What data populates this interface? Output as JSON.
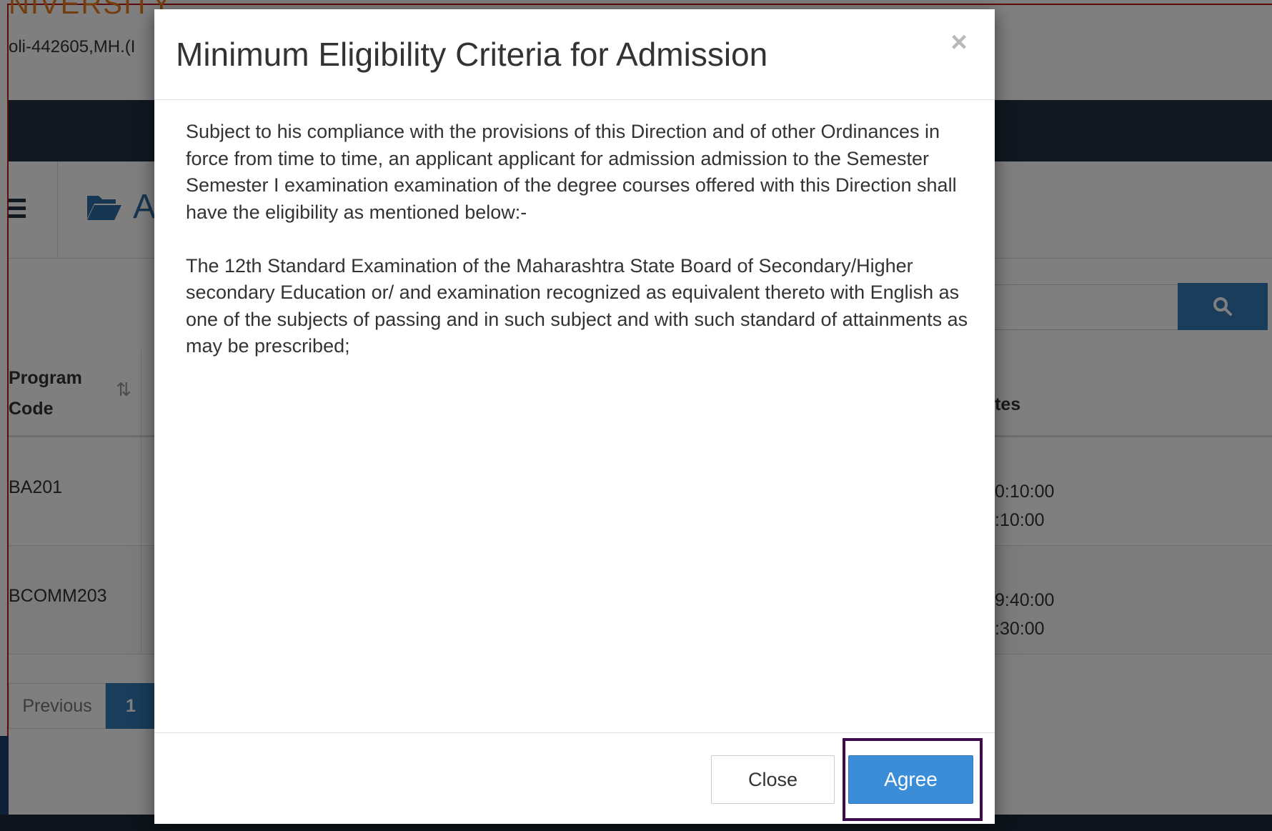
{
  "background": {
    "university_name": "NIVERSITY",
    "address": "oli-442605,MH.(I",
    "subbar_title": "Ap",
    "table": {
      "header_program": "Program Code",
      "header_dates": "tes",
      "rows": [
        {
          "code": "BA201",
          "dates_line1": "0:10:00",
          "dates_line2": ":10:00"
        },
        {
          "code": "BCOMM203",
          "dates_line1": "9:40:00",
          "dates_line2": ":30:00"
        }
      ]
    },
    "pager": {
      "previous": "Previous",
      "page1": "1"
    }
  },
  "modal": {
    "title": "Minimum Eligibility Criteria for Admission",
    "close_x": "×",
    "paragraphs": [
      "Subject to his compliance with the provisions of this Direction and of other Ordinances in force from time to time, an applicant applicant for admission admission to the Semester Semester I examination examination of the degree courses offered with this Direction shall have the eligibility as mentioned below:-",
      "The 12th Standard Examination of the Maharashtra State Board of Secondary/Higher secondary Education or/ and examination recognized as equivalent thereto with English as one of the subjects of passing and in such subject and with such standard of attainments as may be prescribed;"
    ],
    "buttons": {
      "close": "Close",
      "agree": "Agree"
    }
  },
  "colors": {
    "navbar": "#223140",
    "primary": "#337ab7",
    "agree_button": "#3c8dd8",
    "highlight_border": "#3d0b4d",
    "university_orange": "#e87a1c"
  },
  "icons": [
    "menu-icon",
    "folder-open-icon",
    "search-icon",
    "sort-icon",
    "close-icon"
  ]
}
